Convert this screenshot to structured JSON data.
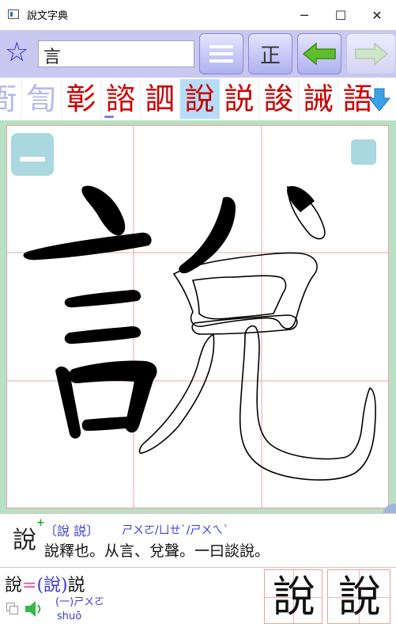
{
  "window": {
    "title": "說文字典",
    "minimize": "─",
    "maximize": "☐",
    "close": "✕"
  },
  "toolbar": {
    "search_value": "言",
    "zheng_label": "正"
  },
  "strip": {
    "chars": [
      "衙",
      "訇",
      "彰",
      "諮",
      "訵",
      "說",
      "説",
      "誜",
      "誡",
      "語"
    ],
    "colors": [
      "#b8b8e8",
      "#b8b8e8",
      "#cc0000",
      "#cc0000",
      "#cc0000",
      "#cc0000",
      "#cc0000",
      "#cc0000",
      "#cc0000",
      "#cc0000"
    ],
    "selected_index": 5
  },
  "info": {
    "seal_char": "說",
    "variants": "〔說 説〕",
    "zhuyin": "ㄕㄨㄛ/ㄩㄝˋ/ㄕㄨㄟˋ",
    "definition": "說釋也。从言、兌聲。一曰談說。"
  },
  "bottom": {
    "equiv_left": "說",
    "equiv_eq": "=",
    "equiv_paren": "(說)",
    "equiv_right": "説",
    "reading_num": "(一)ㄕㄨㄛ",
    "pinyin": "shuō",
    "sample1": "說",
    "sample2": "說"
  },
  "colors": {
    "toolbar_bg": "#c8c8f0",
    "canvas_border": "#b8e0c4",
    "grid_line": "#f0a0a0",
    "accent_blue": "#2929d8",
    "arrow_green": "#5fbf2a",
    "zhuyin_blue": "#3a3ad8",
    "definition_pink": "#e8489a"
  }
}
